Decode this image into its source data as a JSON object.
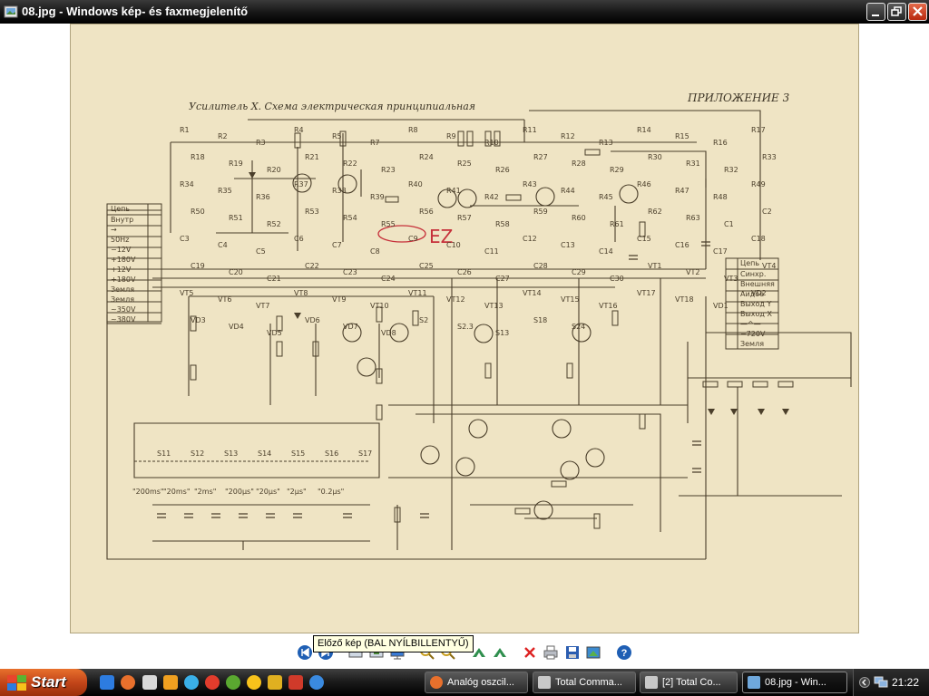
{
  "window": {
    "title": "08.jpg - Windows kép- és faxmegjelenítő",
    "icon": "image-viewer-icon"
  },
  "schematic": {
    "title": "Усилитель X. Схема электрическая принципиальная",
    "appendix": "ПРИЛОЖЕНИЕ 3",
    "annotation": "EZ",
    "connector_left_header": "Цепь",
    "connector_left": [
      "Внутр",
      "→",
      "50Hz",
      "−12V",
      "+180V",
      "+12V",
      "+180V",
      "Земля",
      "Земля",
      "~350V",
      "~380V"
    ],
    "connector_right_header": "Цепь",
    "connector_right": [
      "Синхр.",
      "Внешняя",
      "Аидое",
      "Выход Y",
      "Выход X",
      "—^—",
      "−720V",
      "Земля"
    ],
    "switch_labels": [
      "S11",
      "S12",
      "S13",
      "S14",
      "S15",
      "S16",
      "S17"
    ],
    "timebase_labels": [
      "\"200ms\"",
      "\"20ms\"",
      "\"2ms\"",
      "\"200µs\"",
      "\"20µs\"",
      "\"2µs\"",
      "\"0.2µs\""
    ],
    "component_labels": [
      "R1",
      "R2",
      "R3",
      "R4",
      "R5",
      "R7",
      "R8",
      "R9",
      "R10",
      "R11",
      "R12",
      "R13",
      "R14",
      "R15",
      "R16",
      "R17",
      "R18",
      "R19",
      "R20",
      "R21",
      "R22",
      "R23",
      "R24",
      "R25",
      "R26",
      "R27",
      "R28",
      "R29",
      "R30",
      "R31",
      "R32",
      "R33",
      "R34",
      "R35",
      "R36",
      "R37",
      "R38",
      "R39",
      "R40",
      "R41",
      "R42",
      "R43",
      "R44",
      "R45",
      "R46",
      "R47",
      "R48",
      "R49",
      "R50",
      "R51",
      "R52",
      "R53",
      "R54",
      "R55",
      "R56",
      "R57",
      "R58",
      "R59",
      "R60",
      "R61",
      "R62",
      "R63",
      "C1",
      "C2",
      "C3",
      "C4",
      "C5",
      "C6",
      "C7",
      "C8",
      "C9",
      "C10",
      "C11",
      "C12",
      "C13",
      "C14",
      "C15",
      "C16",
      "C17",
      "C18",
      "C19",
      "C20",
      "C21",
      "C22",
      "C23",
      "C24",
      "C25",
      "C26",
      "C27",
      "C28",
      "C29",
      "C30",
      "VT1",
      "VT2",
      "VT3",
      "VT4",
      "VT5",
      "VT6",
      "VT7",
      "VT8",
      "VT9",
      "VT10",
      "VT11",
      "VT12",
      "VT13",
      "VT14",
      "VT15",
      "VT16",
      "VT17",
      "VT18",
      "VD1",
      "VD2",
      "VD3",
      "VD4",
      "VD5",
      "VD6",
      "VD7",
      "VD8",
      "S2",
      "S2.3",
      "S13",
      "S18",
      "S24"
    ]
  },
  "toolbar": {
    "tooltip": "Előző kép (BAL NYÍLBILLENTYŰ)",
    "buttons": [
      "previous-image-icon",
      "next-image-icon",
      "best-fit-icon",
      "actual-size-icon",
      "slideshow-icon",
      "zoom-in-icon",
      "zoom-out-icon",
      "rotate-clockwise-icon",
      "rotate-counterclockwise-icon",
      "delete-icon",
      "print-icon",
      "save-icon",
      "edit-icon",
      "help-icon"
    ]
  },
  "taskbar": {
    "start_label": "Start",
    "quick_launch": [
      "ie-icon",
      "firefox-icon",
      "explorer-icon",
      "winamp-icon",
      "messenger-icon",
      "chrome-icon",
      "utorrent-icon",
      "emoticon-icon",
      "media-icon",
      "flash-icon",
      "play-icon"
    ],
    "tasks": [
      {
        "label": "Analóg oszcil...",
        "icon": "firefox-icon",
        "active": false
      },
      {
        "label": "Total Comma...",
        "icon": "total-commander-icon",
        "active": false
      },
      {
        "label": "[2] Total Co...",
        "icon": "total-commander-icon",
        "active": false
      },
      {
        "label": "08.jpg - Win...",
        "icon": "image-viewer-icon",
        "active": true
      }
    ],
    "clock": "21:22"
  },
  "colors": {
    "paper": "#efe4c4",
    "ink": "#4a3e2a",
    "marker": "#c6303a",
    "close_button": "#c7361a",
    "start_button": "#c3461a"
  }
}
